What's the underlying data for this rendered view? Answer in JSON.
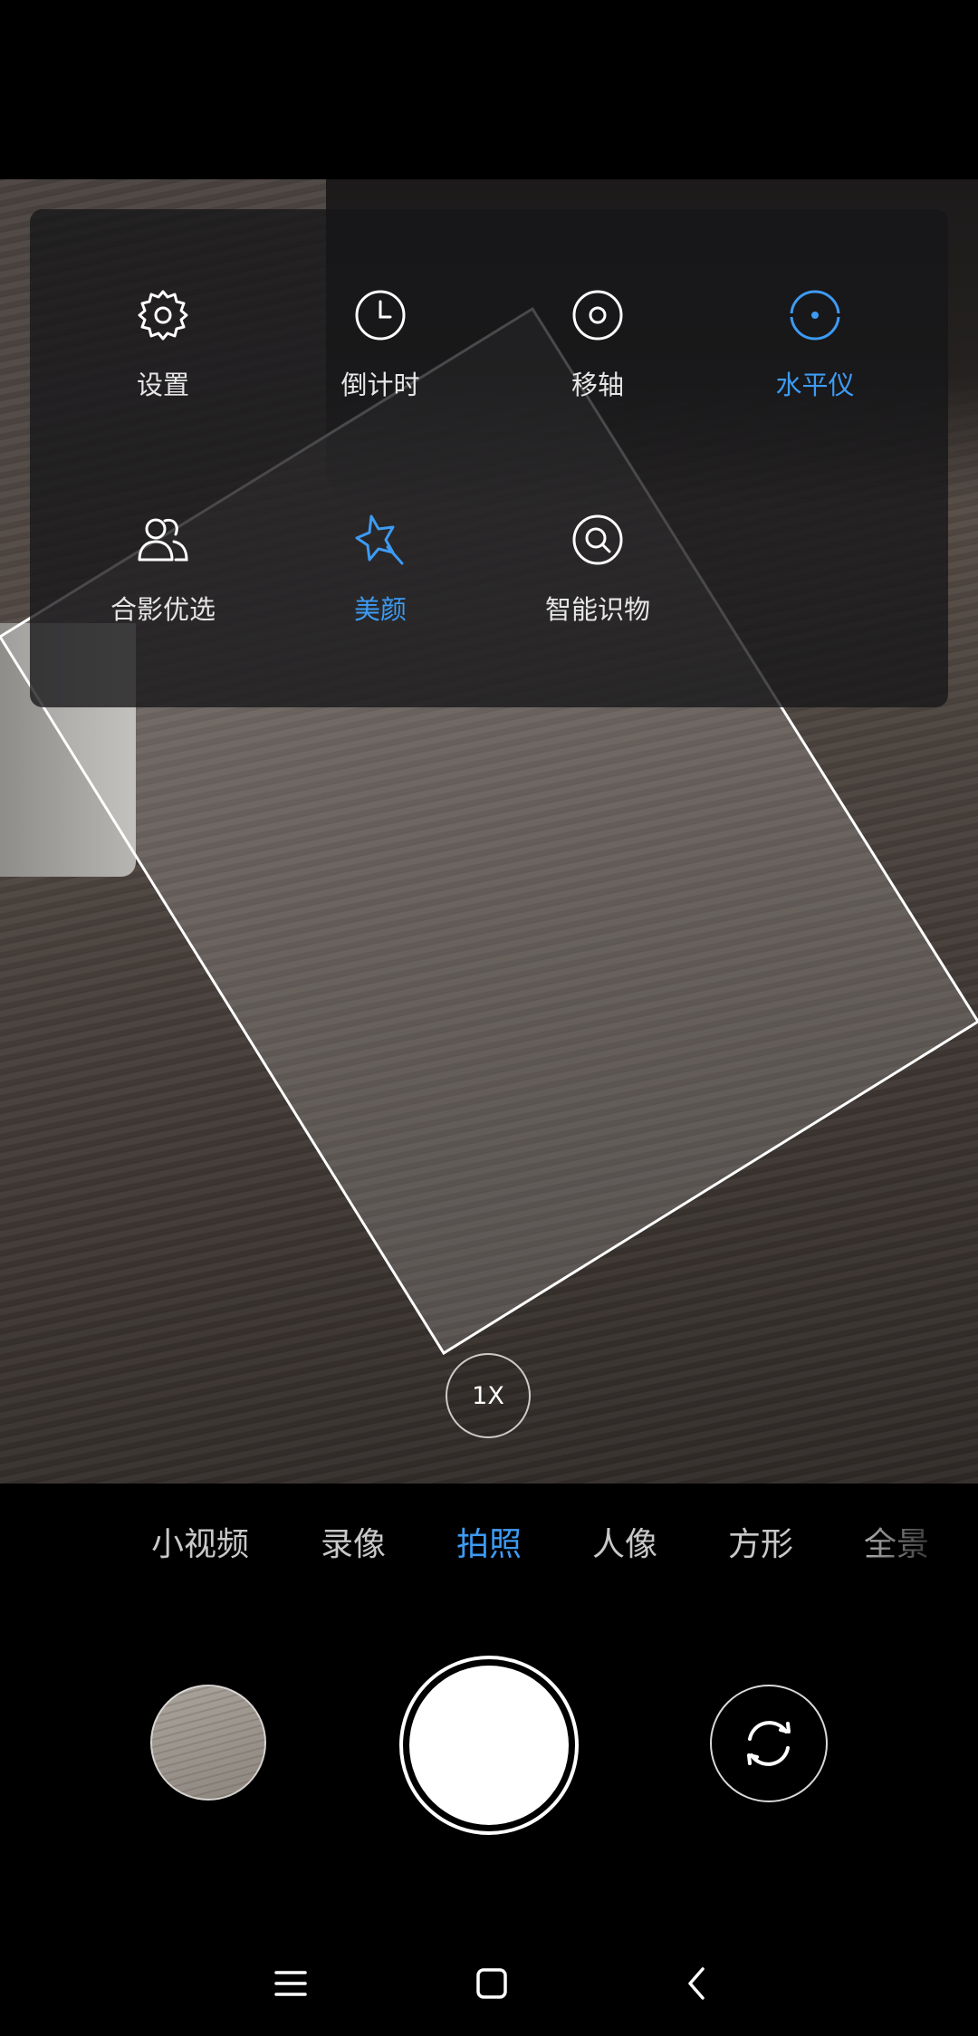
{
  "settings_panel": {
    "items": [
      {
        "label": "设置",
        "icon": "gear-icon",
        "active": false
      },
      {
        "label": "倒计时",
        "icon": "timer-icon",
        "active": false
      },
      {
        "label": "移轴",
        "icon": "tilt-shift-icon",
        "active": false
      },
      {
        "label": "水平仪",
        "icon": "level-icon",
        "active": true
      },
      {
        "label": "合影优选",
        "icon": "group-photo-icon",
        "active": false
      },
      {
        "label": "美颜",
        "icon": "beauty-icon",
        "active": true
      },
      {
        "label": "智能识物",
        "icon": "smart-recognition-icon",
        "active": false
      }
    ]
  },
  "zoom": {
    "label": "1X"
  },
  "modes": {
    "items": [
      {
        "label": "小视频",
        "active": false
      },
      {
        "label": "录像",
        "active": false
      },
      {
        "label": "拍照",
        "active": true
      },
      {
        "label": "人像",
        "active": false
      },
      {
        "label": "方形",
        "active": false
      },
      {
        "label": "全景",
        "active": false
      }
    ]
  },
  "controls": {
    "gallery_icon": "gallery-thumbnail",
    "shutter_icon": "shutter-button",
    "switch_icon": "switch-camera-icon"
  },
  "nav": {
    "menu_icon": "menu-icon",
    "home_icon": "home-icon",
    "back_icon": "back-icon"
  },
  "colors": {
    "accent": "#3d9bf3",
    "panel": "#161618",
    "text": "#e6e6e6"
  }
}
